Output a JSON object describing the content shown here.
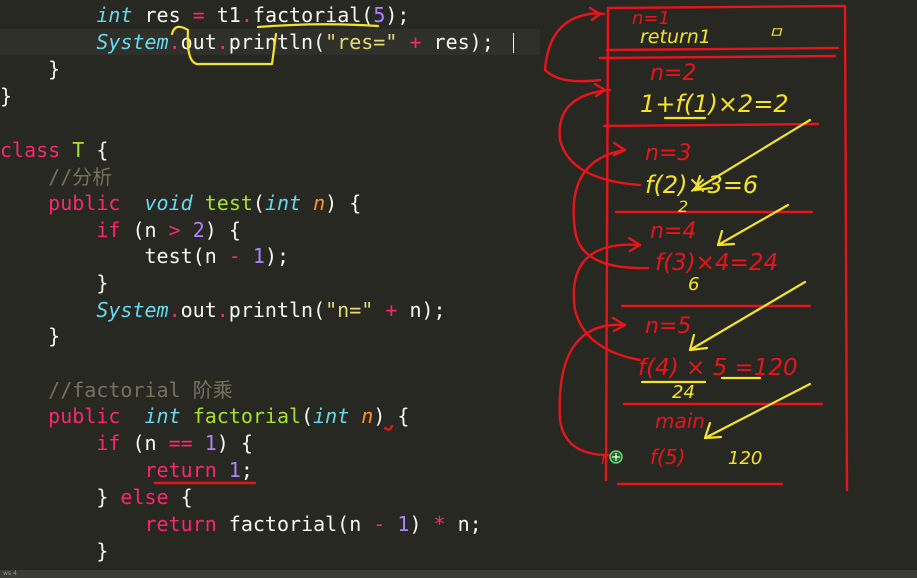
{
  "code": {
    "l1": {
      "kw_type": "int",
      "var": "res",
      "eq": "=",
      "obj": "t1",
      "dot": ".",
      "method": "factorial",
      "open": "(",
      "arg": "5",
      "close": ");"
    },
    "l2": {
      "cls": "System",
      "dot": ".",
      "out": "out",
      "dot2": ".",
      "println": "println",
      "open": "(",
      "str": "\"res=\"",
      "plus": "+",
      "var": "res",
      "close": ");"
    },
    "l3": "}",
    "l4": "}",
    "l5": {
      "kw": "class",
      "name": "T",
      "brace": "{"
    },
    "l6": "//分析",
    "l7": {
      "mod": "public",
      "ret": "void",
      "name": "test",
      "open": "(",
      "ptype": "int",
      "pname": "n",
      "close": ") {"
    },
    "l8": {
      "kw": "if",
      "open": "(n",
      "op": ">",
      "num": "2",
      "close": ") {"
    },
    "l9": {
      "call": "test(n",
      "op": "-",
      "num": "1",
      "close": ");"
    },
    "l10": "}",
    "l11": {
      "cls": "System",
      "dot": ".",
      "out": "out",
      "dot2": ".",
      "println": "println",
      "open": "(",
      "str": "\"n=\"",
      "plus": "+",
      "var": "n",
      "close": ");"
    },
    "l12": "}",
    "l13": "//factorial 阶乘",
    "l14": {
      "mod": "public",
      "ret": "int",
      "name": "factorial",
      "open": "(",
      "ptype": "int",
      "pname": "n",
      "close": ") {"
    },
    "l15": {
      "kw": "if",
      "open": "(n",
      "op": "==",
      "num": "1",
      "close": ") {"
    },
    "l16": {
      "kw": "return",
      "num": "1",
      "close": ";"
    },
    "l17": {
      "brace": "}",
      "kw": "else",
      "open": "{"
    },
    "l18": {
      "kw": "return",
      "call": "factorial(n",
      "op": "-",
      "num": "1",
      "close": ")",
      "op2": "*",
      "var": "n;"
    },
    "l19": "}"
  },
  "annotations": {
    "frame1_n": "n=1",
    "frame1_ret": "return1",
    "frame1_u": "ㅁ",
    "frame2_n": "n=2",
    "frame2_expr": "1+f(1)×2=2",
    "frame3_n": "n=3",
    "frame3_expr": "f(2)×3=6",
    "frame3_sub": "2",
    "frame4_n": "n=4",
    "frame4_expr": "f(3)×4=24",
    "frame4_sub": "6",
    "frame5_n": "n=5",
    "frame5_expr": "f(4) × 5 =120",
    "frame5_sub": "24",
    "frame6_name": "main",
    "frame6_expr": "f(5)",
    "frame6_res": "120",
    "cursor_glyph": "r"
  },
  "statusbar": {
    "text": "ws 4"
  },
  "colors": {
    "background": "#272822",
    "ink_red": "#e8141c",
    "ink_yellow": "#f5e32b"
  }
}
